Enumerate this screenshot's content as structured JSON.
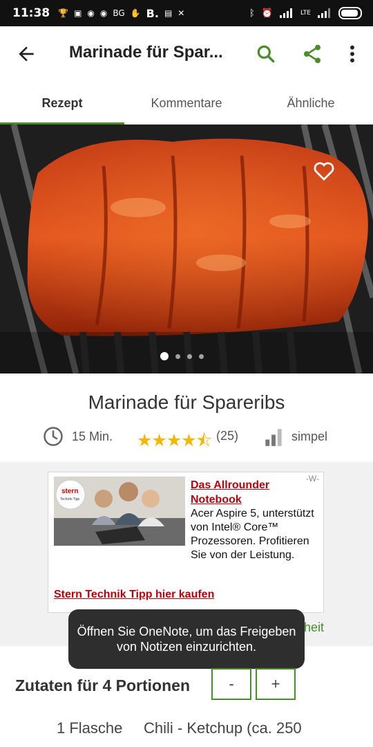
{
  "status_bar": {
    "time": "11:38",
    "notifications": [
      "BG",
      "B."
    ],
    "network": "LTE"
  },
  "app_bar": {
    "title": "Marinade für Spar..."
  },
  "tabs": [
    {
      "label": "Rezept",
      "active": true
    },
    {
      "label": "Kommentare",
      "active": false
    },
    {
      "label": "Ähnliche",
      "active": false
    }
  ],
  "gallery": {
    "page_count": 4,
    "current_page": 1
  },
  "recipe": {
    "title": "Marinade für Spareribs",
    "time": "15 Min.",
    "rating_stars": "★★★★⯪",
    "rating_value": 4.5,
    "rating_count": "(25)",
    "difficulty": "simpel"
  },
  "ad": {
    "marker": "-W-",
    "headline": "Das Allrounder Notebook",
    "body": "Acer Aspire 5, unterstützt von Intel® Core™ Prozessoren. Profitieren Sie von der Leistung.",
    "cta": "Stern Technik Tipp hier kaufen",
    "image_logo": "stern Technik-Tipp",
    "partial_link": "iheit"
  },
  "toast": {
    "message": "Öffnen Sie OneNote, um das Freigeben von Notizen einzurichten."
  },
  "ingredients": {
    "heading": "Zutaten für 4 Portionen",
    "minus_label": "-",
    "plus_label": "+",
    "items": [
      {
        "quantity": "1 Flasche",
        "name": "Chili - Ketchup (ca. 250"
      }
    ]
  },
  "colors": {
    "accent_green": "#4a8c2a",
    "star_yellow": "#f0b800",
    "ad_red": "#b8000d"
  }
}
